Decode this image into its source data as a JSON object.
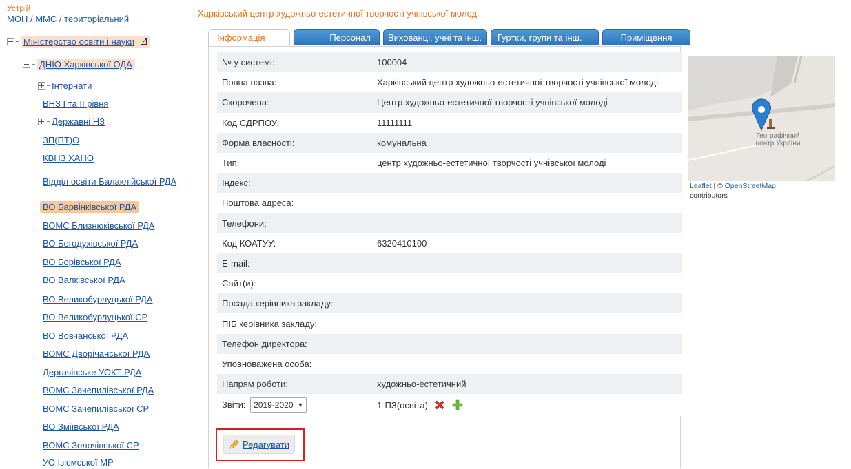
{
  "sidebar": {
    "struct_label": "Устрій",
    "breadcrumb": {
      "mon": "МОН",
      "mms": "ММС",
      "territorial": "територіальний"
    },
    "tree": {
      "ministry": "Міністерство освіти і науки",
      "dnio": "ДНІО Харківської ОДА",
      "internaty": "Інтернати",
      "vnz": "ВНЗ І та ІІ рівня",
      "derzh": "Державні НЗ",
      "zp": "ЗП(ПТ)О",
      "kvnz": "КВНЗ ХАНО",
      "balak": "Відділ освіти Балаклійської РДА",
      "barv": "ВО Барвінківської РДА",
      "blyz": "ВОМС Близнюківської РДА",
      "bohod": "ВО Богодухівської РДА",
      "boriv": "ВО Борівської РДА",
      "valk": "ВО Валківської РДА",
      "velbur_rda": "ВО Великобурлуцької РДА",
      "velbur_sr": "ВО Великобурлуцької СР",
      "vovch": "ВО Вовчанської РДА",
      "dvor": "ВОМС Дворічанської РДА",
      "derh": "Дергачівське УОКТ РДА",
      "zach_rda": "ВОМС Зачепилівської РДА",
      "zach_sr": "ВОМС Зачепилівської СР",
      "zmiiv": "ВО Зміївської РДА",
      "zoloch": "ВОМС Золочівської СР",
      "izium": "УО Ізюмської МР"
    }
  },
  "main": {
    "title": "Харківський центр художньо-естетичної творчості учнівської молоді",
    "tabs": [
      "Інформація",
      "Персонал",
      "Вихованці, учні та інш.",
      "Гуртки, групи та інш.",
      "Приміщення"
    ],
    "rows": [
      {
        "label": "№ у системі:",
        "value": "100004"
      },
      {
        "label": "Повна назва:",
        "value": "Харківський центр художньо-естетичної творчості учнівської молоді"
      },
      {
        "label": "Скорочена:",
        "value": "Центр художньо-естетичної творчості учнівської молоді"
      },
      {
        "label": "Код ЄДРПОУ:",
        "value": "11111111"
      },
      {
        "label": "Форма власності:",
        "value": "комунальна"
      },
      {
        "label": "Тип:",
        "value": "центр художньо-естетичної творчості учнівської молоді"
      },
      {
        "label": "Індекс:",
        "value": ""
      },
      {
        "label": "Поштова адреса:",
        "value": ""
      },
      {
        "label": "Телефони:",
        "value": ""
      },
      {
        "label": "Код КОАТУУ:",
        "value": "6320410100"
      },
      {
        "label": "E-mail:",
        "value": ""
      },
      {
        "label": "Сайт(и):",
        "value": ""
      },
      {
        "label": "Посада керівника закладу:",
        "value": ""
      },
      {
        "label": "ПІБ керівника закладу:",
        "value": ""
      },
      {
        "label": "Телефон директора:",
        "value": ""
      },
      {
        "label": "Уповноважена особа:",
        "value": ""
      },
      {
        "label": "Напрям роботи:",
        "value": "художньо-естетичний"
      }
    ],
    "reports": {
      "label": "Звіти:",
      "year": "2019-2020",
      "report_name": "1-ПЗ(освіта)"
    },
    "edit_label": "Редагувати"
  },
  "map": {
    "place_label": "Географічний центр України",
    "attr_leaflet": "Leaflet",
    "attr_sep": " | © ",
    "attr_osm": "OpenStreetMap",
    "attr_contrib": "contributors"
  },
  "colors": {
    "accent": "#e8711c",
    "link": "#1a55a8",
    "tab_blue": "#3a83c7",
    "highlight": "#d92020"
  }
}
